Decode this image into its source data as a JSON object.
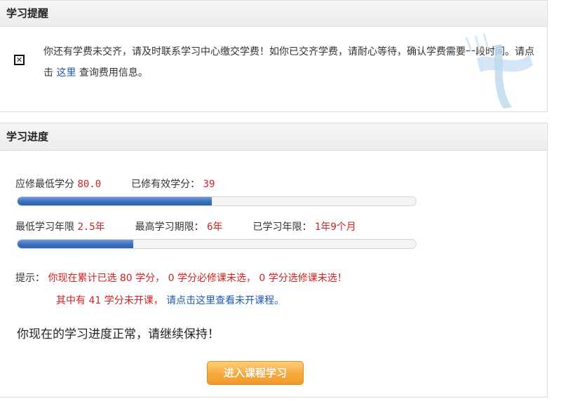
{
  "reminder": {
    "title": "学习提醒",
    "icon": "close-box-icon",
    "message_part1": "你还有学费未交齐，请及时联系学习中心缴交学费！如你已交齐学费，请耐心等待，确认学费需要一段时间。请点击",
    "message_link": "这里",
    "message_part2": "查询费用信息。"
  },
  "progress": {
    "title": "学习进度",
    "credits": {
      "required_label": "应修最低学分",
      "required_value": "80.0",
      "earned_label": "已修有效学分：",
      "earned_value": "39",
      "fill_fraction": 0.4875
    },
    "years": {
      "min_label": "最低学习年限",
      "min_value": "2.5年",
      "max_label": "最高学习期限：",
      "max_value": "6年",
      "studied_label": "已学习年限：",
      "studied_value": "1年9个月",
      "fill_fraction": 0.29
    },
    "tip": {
      "label": "提示：",
      "line1": "你现在累计已选 80 学分， 0 学分必修课未选， 0 学分选修课未选！",
      "line2_text": "其中有 41 学分未开课，",
      "line2_link": "请点击这里查看未开课程。"
    },
    "status_text": "你现在的学习进度正常，请继续保持！",
    "enter_button": "进入课程学习"
  },
  "colors": {
    "accent_red": "#cc2222",
    "link_blue": "#1f58b4",
    "bar_blue": "#3a6fc0",
    "button_orange": "#f6a93b"
  }
}
